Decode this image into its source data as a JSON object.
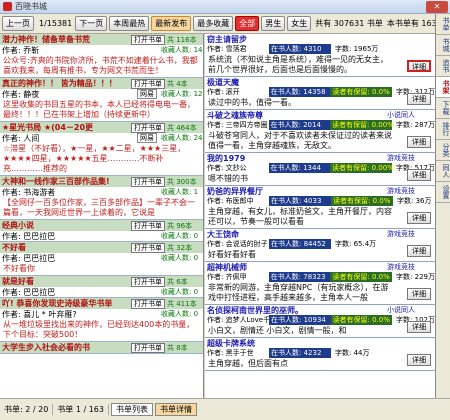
{
  "app": {
    "title": "百晓书城"
  },
  "toolbar": {
    "prev": "上一页",
    "page": "1/15381",
    "next": "下一页",
    "tabs": [
      {
        "label": "本周最热",
        "active": false
      },
      {
        "label": "最新发布",
        "active": true
      },
      {
        "label": "最多收藏",
        "active": false
      },
      {
        "label": "全部",
        "active": false,
        "red": true
      },
      {
        "label": "男生",
        "active": false
      },
      {
        "label": "女生",
        "active": false
      }
    ],
    "total": "共有 307631 书单",
    "count_note": "本书单有 163 本",
    "sort_label": "倒序",
    "close": "×"
  },
  "left_posts": [
    {
      "title": "潜力神作！储备草备书荒",
      "open": "打开书单",
      "count": "共 116本",
      "author": "作者: 乔靳",
      "rec": "",
      "rec_count": "收藏人数: 14",
      "body": "公众号:齐爽的书院你济所，书荒不如逮着什么书，我都喜欢我来，每周有推书，专为网文书荒而生！"
    },
    {
      "title": "真正的神作！！ 皆为精品！！！",
      "open": "打开书单",
      "count": "共 4本",
      "author": "作者: 静夜",
      "rec": "网易",
      "rec_count": "收藏人数: 12",
      "body": "这里收集的书目五星的书本，本人已经将得电电一番，最终！！！已在书架上增加（持续更新中）"
    },
    {
      "title": "★星光书局 ★(04－20更",
      "open": "打开书单",
      "count": "共 464本",
      "author": "作者: 人间",
      "rec": "网易",
      "rec_count": "收藏人数: 24",
      "body": "☆滞星（不好看），★一星，★★二星，★★★三星，★★★★四星，★★★★★五星…………不断补充…………推荐的"
    },
    {
      "title": "大神和一线作家三百部作品集!",
      "open": "打开书单",
      "count": "共 300本",
      "author": "作者: 书海游者",
      "rec": "",
      "rec_count": "收藏人数: 1",
      "body": "【全网仔一百多位作家，三百多部作品】一辈子不会一篇看，一天我网近世界一上读着的，它说是"
    },
    {
      "title": "经典小说",
      "open": "打开书单",
      "count": "共 96本",
      "author": "作者: 巴巴拉巴",
      "rec": "",
      "rec_count": "收藏人数: 0",
      "body": ""
    },
    {
      "title": "不好看",
      "open": "打开书单",
      "count": "共 32本",
      "author": "作者: 巴巴拉巴",
      "rec": "",
      "rec_count": "收藏人数: 0",
      "body": "不好看你"
    },
    {
      "title": "就是好看",
      "open": "打开书单",
      "count": "共 6本",
      "author": "作者: 巴巴拉巴",
      "rec": "",
      "rec_count": "收藏人数: 0",
      "body": ""
    },
    {
      "title": "吖! 恭喜你发现史诗级豪华书单",
      "open": "打开书单",
      "count": "共 411本",
      "author": "作者: 喜儿 * 叶弃雁?",
      "rec": "",
      "rec_count": "收藏人数: 0",
      "body": "从一堆垃圾里找出来的神作，已经到达400本的书量，下个目标：突破500！"
    },
    {
      "title": "大学生步入社会必看的书",
      "open": "打开书单",
      "count": "共 8本",
      "author": "",
      "rec": "",
      "rec_count": "",
      "body": ""
    }
  ],
  "right_books": [
    {
      "title": "窃主请留步",
      "genre": "",
      "author": "作者: 雪落君",
      "readers": "在书人数: 4310",
      "rating": "",
      "words": "字数: 1965万",
      "desc": "系统流（不知说主角是系统），难得一见的无女主，前几个世界很好，后面也是后面慢慢的。",
      "detail": "详细",
      "highlight": true
    },
    {
      "title": "极道天魔",
      "genre": "",
      "author": "作者: 滚开",
      "readers": "在书人数: 14358",
      "rating": "读者有保留: 0.0%",
      "words": "字数: 312万",
      "desc": "读过中的书，值得一看。",
      "detail": "详细",
      "highlight": false
    },
    {
      "title": "斗破之魂族帝尊",
      "genre": "小说同人",
      "author": "作者: 三帝四方帝圈",
      "readers": "在书人数: 2014",
      "rating": "读者有保留: 0.00%",
      "words": "字数: 287万",
      "desc": "斗破苍穹同人，对于不喜欢读者未保证过的读者来说值得一看，主角穿越魂族，无敌文。",
      "detail": "详细",
      "highlight": false
    },
    {
      "title": "我的1979",
      "genre": "游戏竞技",
      "author": "作者: 文抄公",
      "readers": "在书人数: 1344",
      "rating": "读者有保留: 0.00%",
      "words": "字数: 517万",
      "desc": "嗯不错的书",
      "detail": "详细",
      "highlight": false
    },
    {
      "title": "奶爸的异界餐厅",
      "genre": "游戏竞技",
      "author": "作者: 布医郎中",
      "readers": "在书人数: 4033",
      "rating": "读者有保留: 0.0%",
      "words": "字数: 36万",
      "desc": "主角穿越，有女儿，标准奶爸文，主角开餐厅，内容还可以，节奏一般可以看看",
      "detail": "详细",
      "highlight": false
    },
    {
      "title": "大王饶命",
      "genre": "游戏竞技",
      "author": "作者: 会说话的肘子",
      "readers": "在书人数: 84452",
      "rating": "",
      "words": "字数: 65.4万",
      "desc": "好看好看好看",
      "detail": "详细",
      "highlight": false
    },
    {
      "title": "超神机械师",
      "genre": "游戏竞技",
      "author": "作者: 齐佩甲",
      "readers": "在书人数: 78323",
      "rating": "读者有保留: 0.0%",
      "words": "字数: 229万",
      "desc": "非常新的网游，主角穿越NPC（有玩家概念），在游戏中打怪进程，高手越来越多，主角本人一般",
      "detail": "详细",
      "highlight": false
    },
    {
      "title": "名侦探柯南世界里的巫师。",
      "genre": "小说同人",
      "author": "作者: 追梦人Love千",
      "readers": "在书人数: 10934",
      "rating": "读者有保留: 0.0%",
      "words": "字数: 102万",
      "desc": "小白文，剧情还 小白文，剧情一般，和",
      "detail": "详细",
      "highlight": false
    },
    {
      "title": "超级卡牌系统",
      "genre": "",
      "author": "作者: 黑手于世",
      "readers": "在书人数: 4232",
      "rating": "",
      "words": "字数: 44万",
      "desc": "主角穿越，但后面有点",
      "detail": "详细",
      "highlight": false
    }
  ],
  "vtabs": [
    {
      "label": "书单",
      "selected": false
    },
    {
      "label": "书城",
      "selected": false
    },
    {
      "label": "追书",
      "selected": false
    },
    {
      "label": "书架",
      "selected": true
    },
    {
      "label": "下载",
      "selected": false
    },
    {
      "label": "排行",
      "selected": false
    },
    {
      "label": "分类",
      "selected": false
    },
    {
      "label": "同人",
      "selected": false
    },
    {
      "label": "设置",
      "selected": false
    }
  ],
  "status": {
    "book_count": "书单: 2 / 20",
    "page": "书单 1 / 163",
    "tab1": "书单列表",
    "tab2": "书单详情"
  }
}
